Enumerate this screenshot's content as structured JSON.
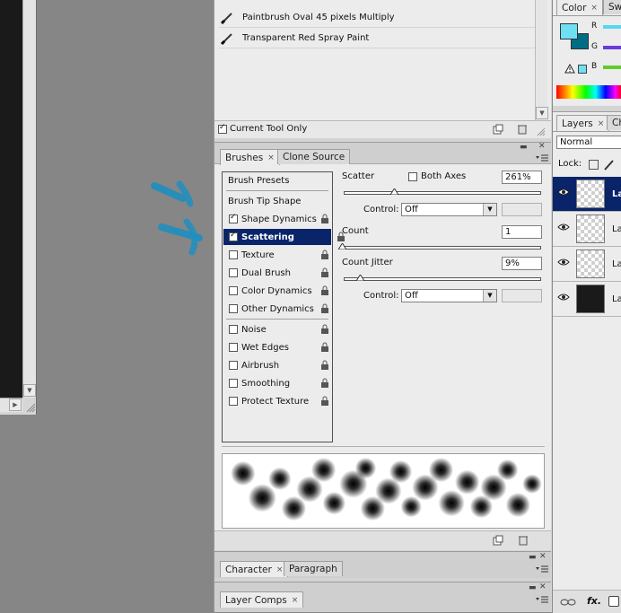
{
  "tool_presets": {
    "items": [
      {
        "label": "Paintbrush Oval 45 pixels Multiply"
      },
      {
        "label": "Transparent Red Spray Paint"
      }
    ],
    "current_tool_only_label": "Current Tool Only",
    "current_tool_only_checked": true
  },
  "brushes_panel": {
    "tabs": [
      {
        "label": "Brushes",
        "active": true
      },
      {
        "label": "Clone Source",
        "active": false
      }
    ],
    "close_glyph": "×",
    "list": {
      "presets_label": "Brush Presets",
      "tip_shape_label": "Brush Tip Shape",
      "options": [
        {
          "label": "Shape Dynamics",
          "checked": true,
          "selected": false
        },
        {
          "label": "Scattering",
          "checked": true,
          "selected": true
        },
        {
          "label": "Texture",
          "checked": false,
          "selected": false
        },
        {
          "label": "Dual Brush",
          "checked": false,
          "selected": false
        },
        {
          "label": "Color Dynamics",
          "checked": false,
          "selected": false
        },
        {
          "label": "Other Dynamics",
          "checked": false,
          "selected": false
        }
      ],
      "extras": [
        {
          "label": "Noise",
          "checked": false
        },
        {
          "label": "Wet Edges",
          "checked": false
        },
        {
          "label": "Airbrush",
          "checked": false
        },
        {
          "label": "Smoothing",
          "checked": false
        },
        {
          "label": "Protect Texture",
          "checked": false
        }
      ]
    },
    "scatter": {
      "label": "Scatter",
      "both_axes_label": "Both Axes",
      "both_axes_checked": false,
      "value": "261%",
      "control_label": "Control:",
      "control_value": "Off"
    },
    "count": {
      "label": "Count",
      "value": "1"
    },
    "count_jitter": {
      "label": "Count Jitter",
      "value": "9%",
      "control_label": "Control:",
      "control_value": "Off"
    }
  },
  "character_panel": {
    "tabs": [
      {
        "label": "Character",
        "active": true
      },
      {
        "label": "Paragraph",
        "active": false
      }
    ]
  },
  "layer_comps_panel": {
    "tabs": [
      {
        "label": "Layer Comps",
        "active": true
      }
    ]
  },
  "color_panel": {
    "tabs": [
      {
        "label": "Color",
        "active": true
      },
      {
        "label": "Sw",
        "active": false
      }
    ],
    "channels": [
      "R",
      "G",
      "B"
    ],
    "foreground_color": "#6fe0f4",
    "background_color": "#006d84"
  },
  "layers_panel": {
    "tabs": [
      {
        "label": "Layers",
        "active": true
      },
      {
        "label": "Ch",
        "active": false
      }
    ],
    "blend_mode": "Normal",
    "lock_label": "Lock:",
    "layers": [
      {
        "name": "La",
        "selected": true,
        "thumb": "transparent"
      },
      {
        "name": "La",
        "selected": false,
        "thumb": "transparent"
      },
      {
        "name": "La",
        "selected": false,
        "thumb": "transparent"
      },
      {
        "name": "La",
        "selected": false,
        "thumb": "black"
      }
    ],
    "fx_label": "fx."
  },
  "colors": {
    "selection": "#0a246a",
    "stroke": "#1e8fbf"
  }
}
